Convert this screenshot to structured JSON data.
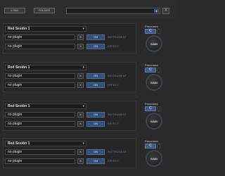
{
  "toolbar": {
    "load_label": "LOAD",
    "folder_label": "FOLDER",
    "selector_arrow": "▾",
    "close_label": "X"
  },
  "sections": [
    {
      "title": "Red Sesión 1",
      "plugins": [
        {
          "name": "no plugin",
          "remove": "X",
          "toggle": "ON",
          "type": "INSTRUMENT"
        },
        {
          "name": "no plugin",
          "remove": "X",
          "toggle": "ON",
          "type": "EFFECT"
        }
      ],
      "pan_label": "Panorama",
      "pan_value": "C",
      "knob_label": "GAIN"
    },
    {
      "title": "Red Sesión 1",
      "plugins": [
        {
          "name": "no plugin",
          "remove": "X",
          "toggle": "ON",
          "type": "INSTRUMENT"
        },
        {
          "name": "no plugin",
          "remove": "X",
          "toggle": "ON",
          "type": "EFFECT"
        }
      ],
      "pan_label": "Panorama",
      "pan_value": "C",
      "knob_label": "GAIN"
    },
    {
      "title": "Red Sesión 1",
      "plugins": [
        {
          "name": "no plugin",
          "remove": "X",
          "toggle": "ON",
          "type": "INSTRUMENT"
        },
        {
          "name": "no plugin",
          "remove": "X",
          "toggle": "ON",
          "type": "EFFECT"
        }
      ],
      "pan_label": "Panorama",
      "pan_value": "C",
      "knob_label": "GAIN"
    },
    {
      "title": "Red Sesión 1",
      "plugins": [
        {
          "name": "no plugin",
          "remove": "X",
          "toggle": "ON",
          "type": "INSTRUMENT"
        },
        {
          "name": "no plugin",
          "remove": "X",
          "toggle": "ON",
          "type": "EFFECT"
        }
      ],
      "pan_label": "Panorama",
      "pan_value": "C",
      "knob_label": "GAIN"
    }
  ],
  "colors": {
    "accent": "#3b5a86",
    "background": "#2a2a2a",
    "panel": "#262626"
  }
}
